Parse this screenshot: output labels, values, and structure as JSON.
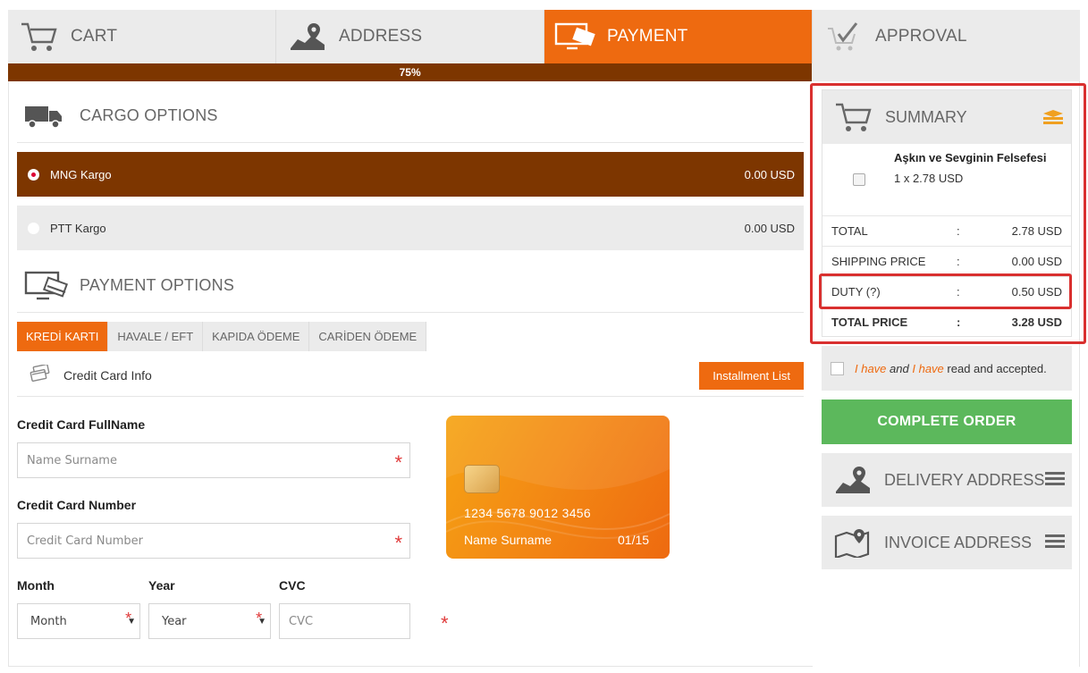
{
  "steps": [
    {
      "label": "CART",
      "icon": "cart-icon",
      "active": false
    },
    {
      "label": "ADDRESS",
      "icon": "map-pin-icon",
      "active": false
    },
    {
      "label": "PAYMENT",
      "icon": "monitor-card-icon",
      "active": true
    },
    {
      "label": "APPROVAL",
      "icon": "checkmark-cart-icon",
      "active": false
    }
  ],
  "progress": {
    "text": "75%",
    "value": 0.75
  },
  "colors": {
    "accent": "#ee6a10",
    "dark": "#7d3600",
    "success": "#5cb85c",
    "highlight": "#d9302f"
  },
  "cargo": {
    "title": "CARGO OPTIONS",
    "options": [
      {
        "name": "MNG Kargo",
        "price": "0.00 USD",
        "selected": true
      },
      {
        "name": "PTT Kargo",
        "price": "0.00 USD",
        "selected": false
      }
    ]
  },
  "payment": {
    "title": "PAYMENT OPTIONS",
    "tabs": [
      "KREDİ KARTI",
      "HAVALE / EFT",
      "KAPIDA ÖDEME",
      "CARİDEN ÖDEME"
    ],
    "active_tab": 0,
    "cc_info_label": "Credit Card Info",
    "installment_button": "Installment List",
    "fields": {
      "fullname_label": "Credit Card FullName",
      "fullname_placeholder": "Name Surname",
      "number_label": "Credit Card Number",
      "number_placeholder": "Credit Card Number",
      "month_label": "Month",
      "month_value": "Month",
      "year_label": "Year",
      "year_value": "Year",
      "cvc_label": "CVC",
      "cvc_placeholder": "CVC",
      "required_mark": "*"
    },
    "card_preview": {
      "number": "1234 5678 9012 3456",
      "holder": "Name Surname",
      "expiry": "01/15"
    }
  },
  "summary": {
    "title": "SUMMARY",
    "product": {
      "name": "Aşkın ve Sevginin Felsefesi",
      "qty_price": "1 x 2.78 USD"
    },
    "rows": [
      {
        "label": "TOTAL",
        "sep": ":",
        "value": "2.78 USD",
        "bold": false
      },
      {
        "label": "SHIPPING PRICE",
        "sep": ":",
        "value": "0.00 USD",
        "bold": false
      },
      {
        "label": "DUTY (?)",
        "sep": ":",
        "value": "0.50 USD",
        "bold": false
      },
      {
        "label": "TOTAL PRICE",
        "sep": ":",
        "value": "3.28 USD",
        "bold": true
      }
    ]
  },
  "agreement": {
    "link1": "I have",
    "and": "and",
    "link2": "I have",
    "suffix": "read and accepted."
  },
  "complete_button": "COMPLETE ORDER",
  "delivery_address": {
    "title": "DELIVERY ADDRESS"
  },
  "invoice_address": {
    "title": "INVOICE ADDRESS"
  }
}
